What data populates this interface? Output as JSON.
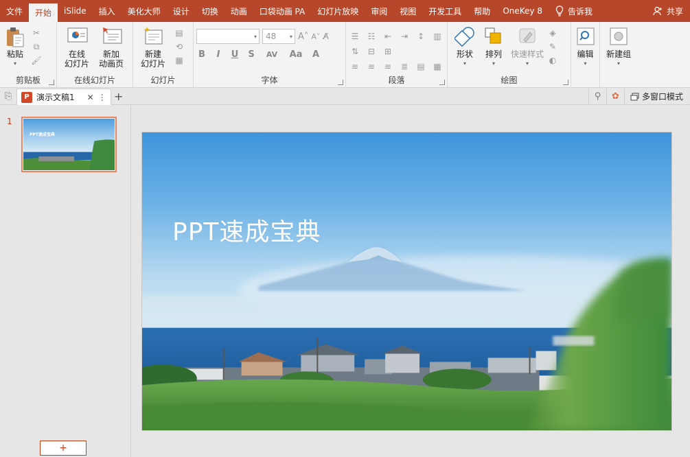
{
  "menu": {
    "tabs": [
      "文件",
      "开始",
      "iSlide",
      "插入",
      "美化大师",
      "设计",
      "切换",
      "动画",
      "口袋动画 PA",
      "幻灯片放映",
      "审阅",
      "视图",
      "开发工具",
      "帮助",
      "OneKey 8"
    ],
    "active_index": 1,
    "tell_me": "告诉我",
    "share": "共享"
  },
  "ribbon": {
    "clipboard": {
      "paste": "粘贴",
      "label": "剪贴板"
    },
    "online": {
      "online_slides_l1": "在线",
      "online_slides_l2": "幻灯片",
      "new_anim_l1": "新加",
      "new_anim_l2": "动画页",
      "label": "在线幻灯片"
    },
    "slides": {
      "new_slide_l1": "新建",
      "new_slide_l2": "幻灯片",
      "label": "幻灯片"
    },
    "font": {
      "font_name": "",
      "font_size": "48",
      "label": "字体",
      "buttons": [
        "B",
        "I",
        "U",
        "S",
        "AV",
        "Aa",
        "A"
      ]
    },
    "paragraph": {
      "label": "段落"
    },
    "drawing": {
      "shape": "形状",
      "arrange": "排列",
      "quick_style": "快速样式",
      "label": "绘图"
    },
    "editing": {
      "edit": "编辑"
    },
    "new_group": {
      "label": "新建组"
    }
  },
  "doc_tab": {
    "logo": "P",
    "title": "演示文稿1",
    "multi_window": "多窗口模式"
  },
  "slides_pane": {
    "slide_number": "1",
    "add_symbol": "+"
  },
  "slide": {
    "title": "PPT速成宝典"
  },
  "colors": {
    "accent": "#b7472a",
    "active_border": "#e9825f"
  }
}
